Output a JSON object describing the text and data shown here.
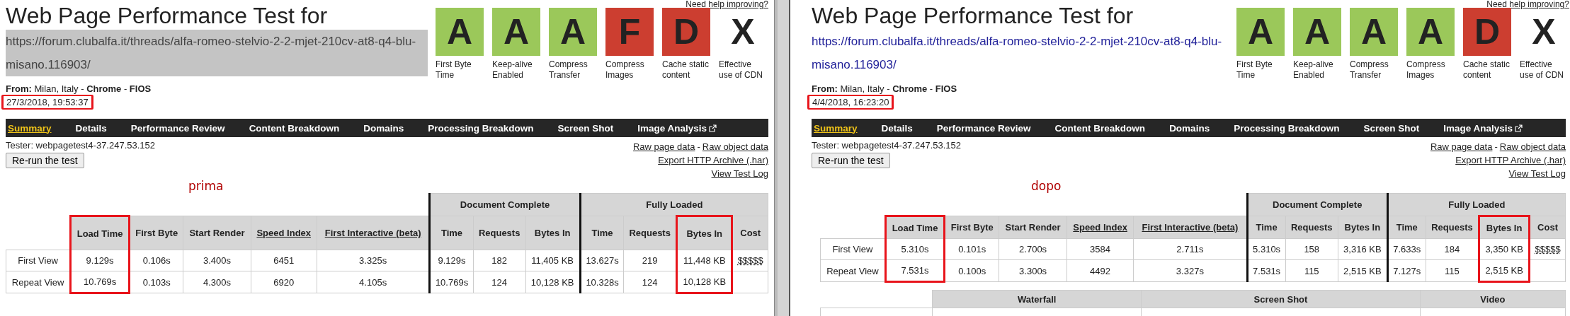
{
  "panels": [
    {
      "title": "Web Page Performance Test for",
      "url": {
        "text": "https://forum.clubalfa.it/threads/alfa-romeo-stelvio-2-2-mjet-210cv-at8-q4-blu-misano.116903/",
        "selected": true
      },
      "from": "**From:** Milan, Italy - **Chrome** - **FIOS**",
      "date": {
        "text": "27/3/2018, 19:53:37",
        "highlighted": true
      },
      "help_link": "Need help improving?",
      "grades": [
        {
          "grade": "A",
          "label": "First Byte Time",
          "color": "#9bc85a"
        },
        {
          "grade": "A",
          "label": "Keep-alive Enabled",
          "color": "#9bc85a"
        },
        {
          "grade": "A",
          "label": "Compress Transfer",
          "color": "#9bc85a"
        },
        {
          "grade": "F",
          "label": "Compress Images",
          "color": "#cc3e30"
        },
        {
          "grade": "D",
          "label": "Cache static content",
          "color": "#cc3e30"
        },
        {
          "grade": "X",
          "label": "Effective use of CDN"
        }
      ],
      "nav": [
        {
          "label": "Summary",
          "selected": true,
          "external": false
        },
        {
          "label": "Details",
          "selected": false,
          "external": false
        },
        {
          "label": "Performance Review",
          "selected": false,
          "external": false
        },
        {
          "label": "Content Breakdown",
          "selected": false,
          "external": false
        },
        {
          "label": "Domains",
          "selected": false,
          "external": false
        },
        {
          "label": "Processing Breakdown",
          "selected": false,
          "external": false
        },
        {
          "label": "Screen Shot",
          "selected": false,
          "external": false
        },
        {
          "label": "Image Analysis",
          "selected": false,
          "external": true
        }
      ],
      "tester": "Tester: webpagetest4-37.247.53.152",
      "rerun_button": "Re-run the test",
      "links": [
        {
          "items": [
            {
              "label": "Raw page data",
              "kind": "link"
            },
            {
              "label": "-",
              "kind": "text"
            },
            {
              "label": "Raw object data",
              "kind": "link"
            }
          ]
        },
        {
          "items": [
            {
              "label": "Export HTTP Archive (.har)",
              "kind": "link"
            }
          ]
        },
        {
          "items": [
            {
              "label": "View Test Log",
              "kind": "link"
            }
          ]
        }
      ],
      "annotation": "prima",
      "table": {
        "columns": [
          {
            "label": "Load Time",
            "kind": "plain",
            "highlighted": true
          },
          {
            "label": "First Byte",
            "kind": "plain",
            "highlighted": false
          },
          {
            "label": "Start Render",
            "kind": "plain",
            "highlighted": false
          },
          {
            "label": "Speed Index",
            "kind": "link",
            "highlighted": false
          },
          {
            "label": "First Interactive (beta)",
            "kind": "link",
            "highlighted": false
          }
        ],
        "groups": [
          {
            "label": "Document Complete",
            "columns": [
              {
                "label": "Time",
                "kind": "plain",
                "highlighted": false
              },
              {
                "label": "Requests",
                "kind": "plain",
                "highlighted": false
              },
              {
                "label": "Bytes In",
                "kind": "plain",
                "highlighted": false
              }
            ]
          },
          {
            "label": "Fully Loaded",
            "columns": [
              {
                "label": "Time",
                "kind": "plain",
                "highlighted": false
              },
              {
                "label": "Requests",
                "kind": "plain",
                "highlighted": false
              },
              {
                "label": "Bytes In",
                "kind": "plain",
                "highlighted": true
              },
              {
                "label": "Cost",
                "kind": "cost",
                "highlighted": false
              }
            ]
          }
        ],
        "rows": [
          {
            "label": "First View",
            "cells": [
              "9.129s",
              "0.106s",
              "3.400s",
              "6451",
              "3.325s",
              "9.129s",
              "182",
              "11,405 KB",
              "13.627s",
              "219",
              "11,448 KB",
              "$$$$$"
            ]
          },
          {
            "label": "Repeat View",
            "cells": [
              "10.769s",
              "0.103s",
              "4.300s",
              "6920",
              "4.105s",
              "10.769s",
              "124",
              "10,128 KB",
              "10.328s",
              "124",
              "10,128 KB"
            ]
          }
        ]
      }
    },
    {
      "title": "Web Page Performance Test for",
      "url": {
        "text": "https://forum.clubalfa.it/threads/alfa-romeo-stelvio-2-2-mjet-210cv-at8-q4-blu-misano.116903/",
        "selected": false
      },
      "from": "**From:** Milan, Italy - **Chrome** - **FIOS**",
      "date": {
        "text": "4/4/2018, 16:23:20",
        "highlighted": true
      },
      "help_link": "Need help improving?",
      "grades": [
        {
          "grade": "A",
          "label": "First Byte Time",
          "color": "#9bc85a"
        },
        {
          "grade": "A",
          "label": "Keep-alive Enabled",
          "color": "#9bc85a"
        },
        {
          "grade": "A",
          "label": "Compress Transfer",
          "color": "#9bc85a"
        },
        {
          "grade": "A",
          "label": "Compress Images",
          "color": "#9bc85a"
        },
        {
          "grade": "D",
          "label": "Cache static content",
          "color": "#cc3e30"
        },
        {
          "grade": "X",
          "label": "Effective use of CDN"
        }
      ],
      "nav": [
        {
          "label": "Summary",
          "selected": true,
          "external": false
        },
        {
          "label": "Details",
          "selected": false,
          "external": false
        },
        {
          "label": "Performance Review",
          "selected": false,
          "external": false
        },
        {
          "label": "Content Breakdown",
          "selected": false,
          "external": false
        },
        {
          "label": "Domains",
          "selected": false,
          "external": false
        },
        {
          "label": "Processing Breakdown",
          "selected": false,
          "external": false
        },
        {
          "label": "Screen Shot",
          "selected": false,
          "external": false
        },
        {
          "label": "Image Analysis",
          "selected": false,
          "external": true
        }
      ],
      "tester": "Tester: webpagetest4-37.247.53.152",
      "rerun_button": "Re-run the test",
      "links": [
        {
          "items": [
            {
              "label": "Raw page data",
              "kind": "link"
            },
            {
              "label": "-",
              "kind": "text"
            },
            {
              "label": "Raw object data",
              "kind": "link"
            }
          ]
        },
        {
          "items": [
            {
              "label": "Export HTTP Archive (.har)",
              "kind": "link"
            }
          ]
        },
        {
          "items": [
            {
              "label": "View Test Log",
              "kind": "link"
            }
          ]
        }
      ],
      "annotation": "dopo",
      "table": {
        "columns": [
          {
            "label": "Load Time",
            "kind": "plain",
            "highlighted": true
          },
          {
            "label": "First Byte",
            "kind": "plain",
            "highlighted": false
          },
          {
            "label": "Start Render",
            "kind": "plain",
            "highlighted": false
          },
          {
            "label": "Speed Index",
            "kind": "link",
            "highlighted": false
          },
          {
            "label": "First Interactive (beta)",
            "kind": "link",
            "highlighted": false
          }
        ],
        "groups": [
          {
            "label": "Document Complete",
            "columns": [
              {
                "label": "Time",
                "kind": "plain",
                "highlighted": false
              },
              {
                "label": "Requests",
                "kind": "plain",
                "highlighted": false
              },
              {
                "label": "Bytes In",
                "kind": "plain",
                "highlighted": false
              }
            ]
          },
          {
            "label": "Fully Loaded",
            "columns": [
              {
                "label": "Time",
                "kind": "plain",
                "highlighted": false
              },
              {
                "label": "Requests",
                "kind": "plain",
                "highlighted": false
              },
              {
                "label": "Bytes In",
                "kind": "plain",
                "highlighted": true
              },
              {
                "label": "Cost",
                "kind": "cost",
                "highlighted": false
              }
            ]
          }
        ],
        "rows": [
          {
            "label": "First View",
            "cells": [
              "5.310s",
              "0.101s",
              "2.700s",
              "3584",
              "2.711s",
              "5.310s",
              "158",
              "3,316 KB",
              "7.633s",
              "184",
              "3,350 KB",
              "$$$$$"
            ]
          },
          {
            "label": "Repeat View",
            "cells": [
              "7.531s",
              "0.100s",
              "3.300s",
              "4492",
              "3.327s",
              "7.531s",
              "115",
              "2,515 KB",
              "7.127s",
              "115",
              "2,515 KB"
            ]
          }
        ]
      },
      "media_table": {
        "columns": [
          "Waterfall",
          "Screen Shot",
          "Video"
        ]
      }
    }
  ]
}
